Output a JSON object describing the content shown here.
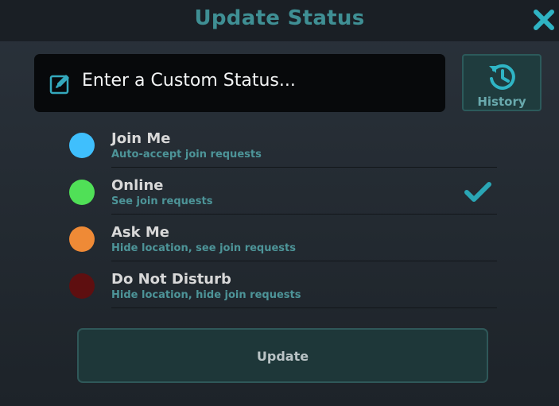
{
  "dialog": {
    "title": "Update Status",
    "close_icon": "close-icon"
  },
  "custom_status": {
    "placeholder": "Enter a Custom Status...",
    "icon": "edit-icon"
  },
  "history": {
    "label": "History",
    "icon": "history-icon"
  },
  "statuses": [
    {
      "name": "Join Me",
      "description": "Auto-accept join requests",
      "color": "#3fbffd",
      "selected": false
    },
    {
      "name": "Online",
      "description": "See join requests",
      "color": "#50e057",
      "selected": true
    },
    {
      "name": "Ask Me",
      "description": "Hide location, see join requests",
      "color": "#ef8a36",
      "selected": false
    },
    {
      "name": "Do Not Disturb",
      "description": "Hide location, hide join requests",
      "color": "#5e0f10",
      "selected": false
    }
  ],
  "selected_icon": "check-icon",
  "update_button": {
    "label": "Update"
  },
  "colors": {
    "accent": "#3f8f94",
    "check": "#2aa6b5",
    "background": "#232a31"
  }
}
